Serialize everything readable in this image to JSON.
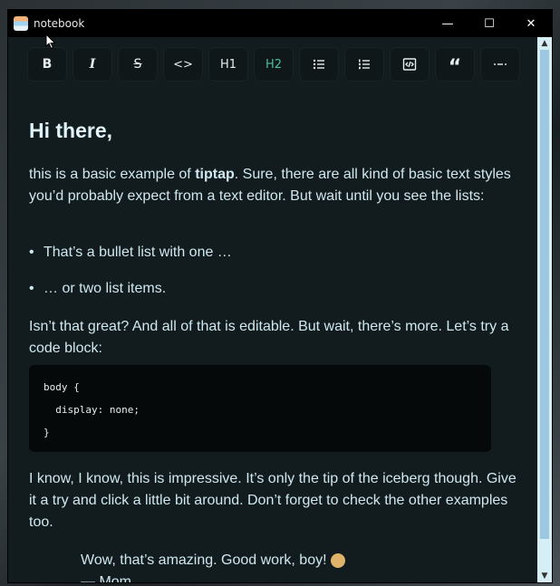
{
  "window": {
    "title": "notebook",
    "controls": {
      "minimize": "—",
      "maximize": "☐",
      "close": "✕"
    }
  },
  "toolbar": {
    "buttons": [
      {
        "name": "bold",
        "label": "B"
      },
      {
        "name": "italic",
        "label": "I"
      },
      {
        "name": "strike",
        "label": "S"
      },
      {
        "name": "code",
        "label": "<>"
      },
      {
        "name": "h1",
        "label": "H1"
      },
      {
        "name": "h2",
        "label": "H2",
        "active": true
      },
      {
        "name": "bullet-list",
        "label": ""
      },
      {
        "name": "ordered-list",
        "label": ""
      },
      {
        "name": "code-block",
        "label": ""
      },
      {
        "name": "blockquote",
        "label": "“"
      },
      {
        "name": "horizontal-rule",
        "label": ""
      }
    ]
  },
  "doc": {
    "heading": "Hi there,",
    "p1_pre": "this is a basic example of ",
    "p1_bold": "tiptap",
    "p1_post": ". Sure, there are all kind of basic text styles you’d probably expect from a text editor. But wait until you see the lists:",
    "bullets": [
      "That’s a bullet list with one …",
      "… or two list items."
    ],
    "p2": "Isn’t that great? And all of that is editable. But wait, there’s more. Let’s try a code block:",
    "code": [
      "body {",
      "  display: none;",
      "}"
    ],
    "p3": "I know, I know, this is impressive. It’s only the tip of the iceberg though. Give it a try and click a little bit around. Don’t forget to check the other examples too.",
    "quote": "Wow, that’s amazing. Good work, boy!",
    "quote_author": "— Mom"
  },
  "colors": {
    "accent": "#4fbf9f",
    "background": "#121c1f",
    "code_bg": "#05090a"
  }
}
